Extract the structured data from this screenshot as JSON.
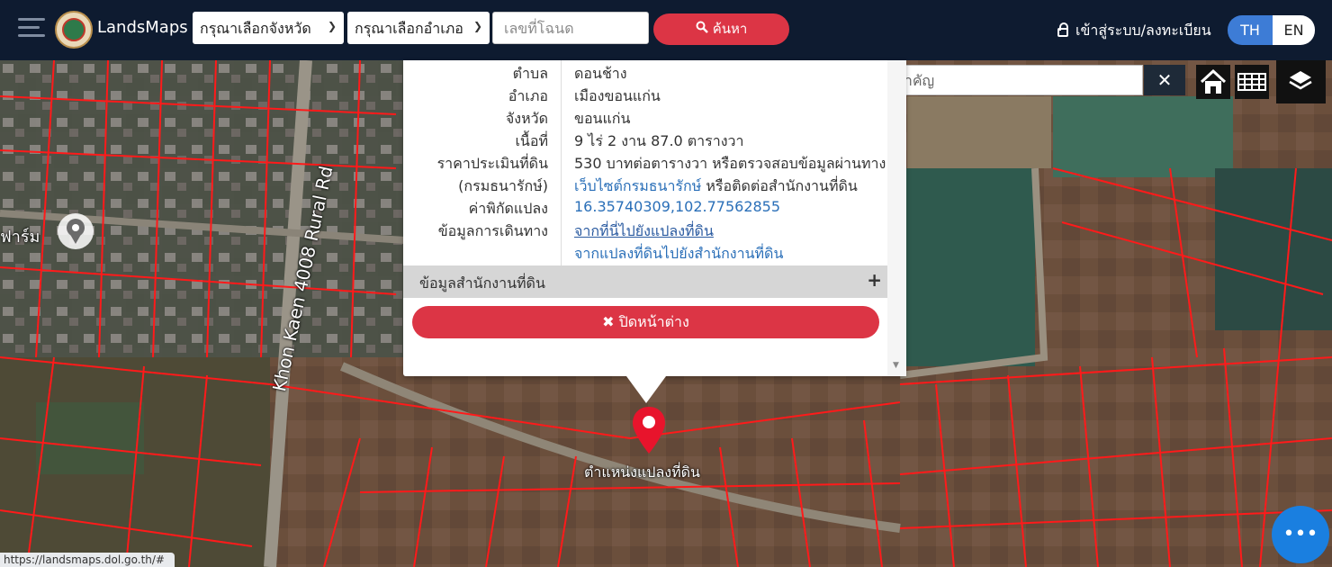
{
  "header": {
    "brand": "LandsMaps",
    "province_select": "กรุณาเลือกจังหวัด",
    "district_select": "กรุณาเลือกอำเภอ",
    "deed_placeholder": "เลขที่โฉนด",
    "search_label": "ค้นหา",
    "login_label": "เข้าสู่ระบบ/ลงทะเบียน",
    "lang_th": "TH",
    "lang_en": "EN"
  },
  "map_controls": {
    "place_search_placeholder": "ค้นหาสถานที่สำคัญ",
    "clear_label": "✕"
  },
  "popup": {
    "rows": [
      {
        "label": "ตำบล",
        "value": "ดอนช้าง"
      },
      {
        "label": "อำเภอ",
        "value": "เมืองขอนแก่น"
      },
      {
        "label": "จังหวัด",
        "value": "ขอนแก่น"
      },
      {
        "label": "เนื้อที่",
        "value": "9 ไร่ 2 งาน 87.0 ตารางวา"
      },
      {
        "label": "ราคาประเมินที่ดิน",
        "value": "530 บาทต่อตารางวา หรือตรวจสอบข้อมูลผ่านทาง"
      },
      {
        "label": "(กรมธนารักษ์)",
        "value_link": "เว็บไซต์กรมธนารักษ์",
        "value_rest": " หรือติดต่อสำนักงานที่ดิน"
      },
      {
        "label": "ค่าพิกัดแปลง",
        "value": "16.35740309,102.77562855"
      },
      {
        "label": "ข้อมูลการเดินทาง",
        "value": "จากที่นี่ไปยังแปลงที่ดิน"
      },
      {
        "label": "",
        "value": "จากแปลงที่ดินไปยังสำนักงานที่ดิน"
      }
    ],
    "office_section": "ข้อมูลสำนักงานที่ดิน",
    "close_label": "✖ ปิดหน้าต่าง"
  },
  "map": {
    "pin_label": "ตำแหน่งแปลงที่ดิน",
    "farm_text": "ฟาร์ม",
    "road_label": "Khon Kaen 4008 Rural Rd"
  },
  "status_url": "https://landsmaps.dol.go.th/#",
  "chat_label": "•••",
  "colors": {
    "header_bg": "#0e1b30",
    "accent_red": "#dc3545",
    "accent_blue": "#3d7cd6",
    "parcel_line": "#ff1a1a"
  }
}
